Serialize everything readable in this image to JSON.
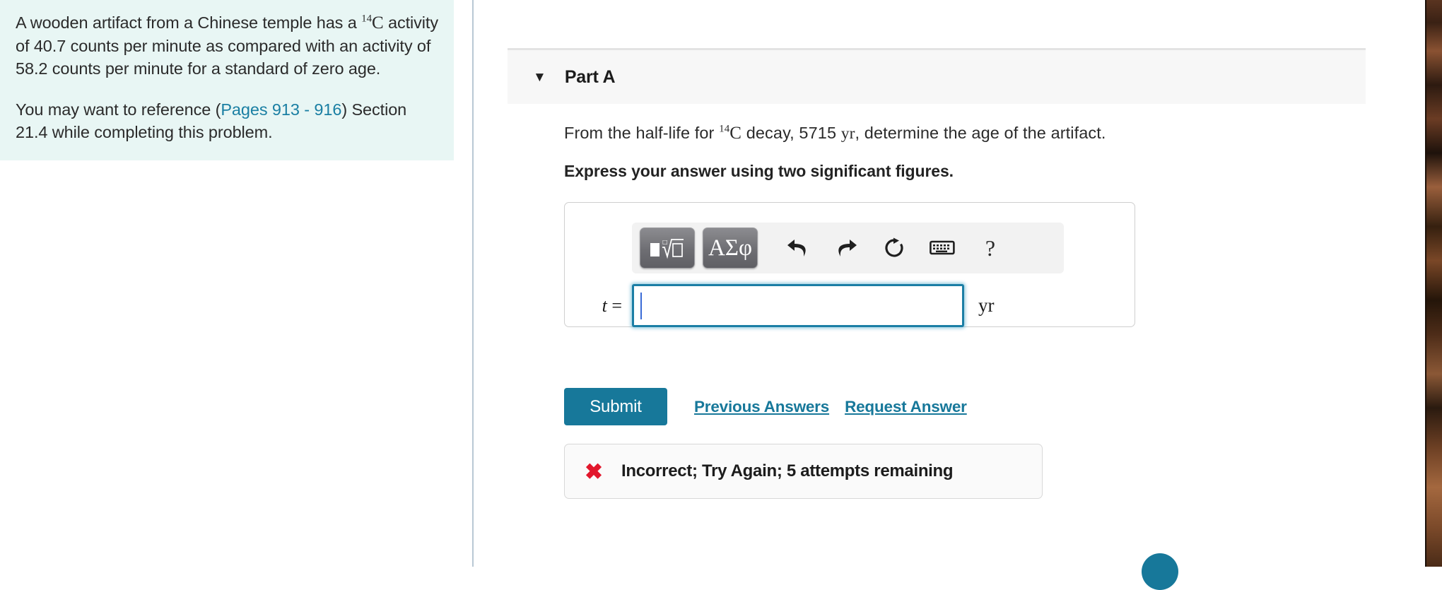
{
  "problem": {
    "paragraph1_before": "A wooden artifact from a Chinese temple has a ",
    "isotope_sup": "14",
    "isotope_el": "C",
    "paragraph1_after": " activity of 40.7 counts per minute as compared with an activity of 58.2 counts per minute for a standard of zero age.",
    "paragraph2_before": "You may want to reference (",
    "reference_link": "Pages 913 - 916",
    "paragraph2_after": ") Section 21.4 while completing this problem."
  },
  "part": {
    "caret_icon": "▼",
    "title": "Part A",
    "question_before": "From the half-life for ",
    "question_sup": "14",
    "question_el": "C",
    "question_after": " decay, 5715 ",
    "question_unit": "yr",
    "question_end": ", determine the age of the artifact.",
    "instruction": "Express your answer using two significant figures."
  },
  "answer_entry": {
    "toolbar": {
      "math_template_label": "math-template",
      "greek_label": "ΑΣφ",
      "undo_label": "undo",
      "redo_label": "redo",
      "reset_label": "reset",
      "keyboard_label": "keyboard",
      "help_label": "?"
    },
    "variable": "t",
    "equals": " =",
    "value": "",
    "unit": "yr"
  },
  "actions": {
    "submit_label": "Submit",
    "previous_answers_label": "Previous Answers",
    "request_answer_label": "Request Answer"
  },
  "feedback": {
    "icon": "✖",
    "message": "Incorrect; Try Again; 5 attempts remaining"
  },
  "colors": {
    "problem_panel_bg": "#e8f6f4",
    "link": "#1a7fa3",
    "accent_teal": "#17789a",
    "error_red": "#e2172c",
    "focus_border": "#1b7ea5"
  }
}
